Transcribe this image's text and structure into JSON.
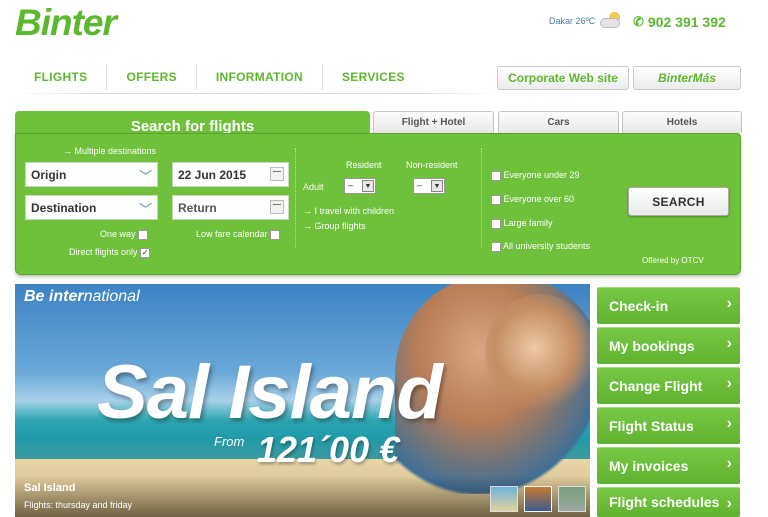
{
  "header": {
    "logo": "Binter",
    "weather": "Dakar 26ºC",
    "phone": "902 391 392"
  },
  "nav": {
    "items": [
      "FLIGHTS",
      "OFFERS",
      "INFORMATION",
      "SERVICES"
    ],
    "corporate": "Corporate Web site",
    "bintermas": "BinterMás"
  },
  "tabs": {
    "active": "Search for flights",
    "others": [
      "Flight + Hotel",
      "Cars",
      "Hotels"
    ]
  },
  "search": {
    "multiple_destinations": "→ Multiple destinations",
    "origin": "Origin",
    "destination": "Destination",
    "depart_date": "22 Jun 2015",
    "return_placeholder": "Return",
    "one_way": "One way",
    "direct_only": "Direct flights only",
    "lowfare": "Low fare calendar",
    "resident": "Resident",
    "non_resident": "Non-resident",
    "adult": "Adult",
    "adult_resident_value": "–",
    "adult_nonresident_value": "–",
    "children_link": "→ I travel with children",
    "group_link": "→ Group flights",
    "discounts": [
      "Everyone under 29",
      "Everyone over 60",
      "Large family",
      "All university students"
    ],
    "search_button": "SEARCH",
    "offered_by": "Offered by OTCV"
  },
  "banner": {
    "tag_bold": "Be inter",
    "tag_thin": "national",
    "title": "Sal Island",
    "from": "From",
    "price": "121´00 €",
    "caption_title": "Sal Island",
    "caption_sub": "Flights: thursday and friday"
  },
  "side_links": [
    "Check-in",
    "My bookings",
    "Change Flight",
    "Flight Status",
    "My invoices",
    "Flight schedules"
  ],
  "colors": {
    "brand_green": "#5cb82e",
    "panel_green": "#6fc03b"
  }
}
